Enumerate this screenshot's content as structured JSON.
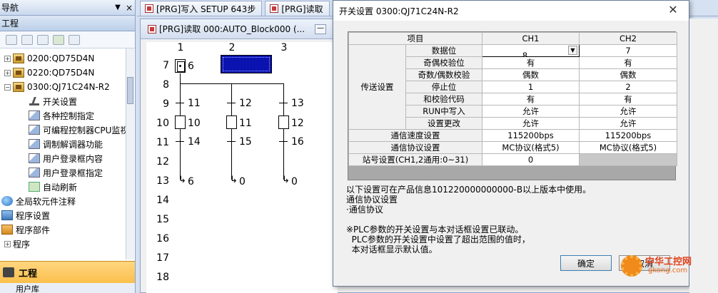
{
  "nav": {
    "title": "导航",
    "section": "工程",
    "tree": [
      {
        "label": "0200:QD75D4N",
        "expander": "+"
      },
      {
        "label": "0220:QD75D4N",
        "expander": "+"
      },
      {
        "label": "0300:QJ71C24N-R2",
        "expander": "−"
      },
      {
        "label": "开关设置"
      },
      {
        "label": "各种控制指定"
      },
      {
        "label": "可编程控制器CPU监视"
      },
      {
        "label": "调制解调器功能"
      },
      {
        "label": "用户登录框内容"
      },
      {
        "label": "用户登录框指定"
      },
      {
        "label": "自动刷新"
      },
      {
        "label": "全局软元件注释"
      },
      {
        "label": "程序设置"
      },
      {
        "label": "程序部件"
      },
      {
        "label": "程序"
      }
    ],
    "bottom_title": "工程",
    "bottom_sub": "用户库"
  },
  "tabs": [
    {
      "label": "[PRG]写入 SETUP 643步"
    },
    {
      "label": "[PRG]读取"
    }
  ],
  "mdi": {
    "title": "[PRG]读取 000:AUTO_Block000 (...",
    "sfc": {
      "columns": [
        "1",
        "2",
        "3"
      ],
      "rows": [
        "7",
        "8",
        "9",
        "10",
        "11",
        "12",
        "13",
        "14",
        "15",
        "16",
        "17",
        "18"
      ],
      "labels": {
        "c1": [
          "6",
          "11",
          "10",
          "14",
          "6"
        ],
        "c2": [
          "12",
          "11",
          "15",
          "0"
        ],
        "c3": [
          "13",
          "12",
          "16",
          "0"
        ]
      }
    }
  },
  "dialog": {
    "title": "开关设置 0300:QJ71C24N-R2",
    "table": {
      "header": [
        "项目",
        "CH1",
        "CH2"
      ],
      "group_label": "传送设置",
      "rows": [
        {
          "label": "数据位",
          "ch1": "8",
          "ch2": "7"
        },
        {
          "label": "奇偶校验位",
          "ch1": "有",
          "ch2": "有"
        },
        {
          "label": "奇数/偶数校验",
          "ch1": "偶数",
          "ch2": "偶数"
        },
        {
          "label": "停止位",
          "ch1": "1",
          "ch2": "2"
        },
        {
          "label": "和校验代码",
          "ch1": "有",
          "ch2": "有"
        },
        {
          "label": "RUN中写入",
          "ch1": "允许",
          "ch2": "允许"
        },
        {
          "label": "设置更改",
          "ch1": "允许",
          "ch2": "允许"
        }
      ],
      "full_rows": [
        {
          "label": "通信速度设置",
          "ch1": "115200bps",
          "ch2": "115200bps"
        },
        {
          "label": "通信协议设置",
          "ch1": "MC协议(格式5)",
          "ch2": "MC协议(格式5)"
        },
        {
          "label": "站号设置(CH1,2通用:0~31)",
          "ch1": "0",
          "ch2": ""
        }
      ]
    },
    "notes": [
      "以下设置可在产品信息101220000000000-B以上版本中使用。",
      "通信协议设置",
      "·通信协议",
      "",
      "※PLC参数的开关设置与本对话框设置已联动。",
      "  PLC参数的开关设置中设置了超出范围的值时，",
      "  本对话框显示默认值。"
    ],
    "ok_label": "确定",
    "cancel_label": "取消"
  },
  "watermark": {
    "name": "中华工控网",
    "url": "gkong.com"
  }
}
